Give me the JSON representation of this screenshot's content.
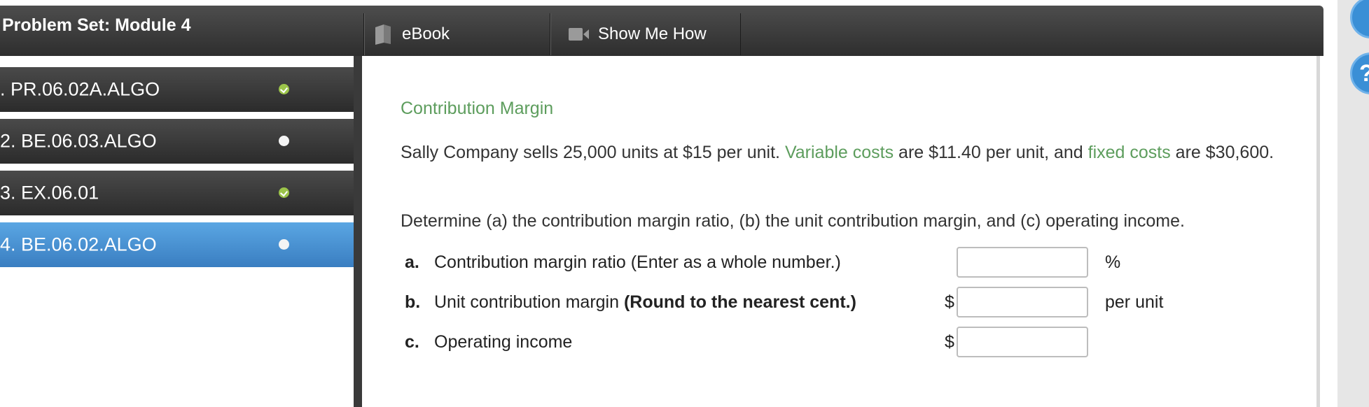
{
  "header": {
    "title": "Problem Set: Module 4",
    "tools": [
      {
        "label": "eBook",
        "icon": "book-icon"
      },
      {
        "label": "Show Me How",
        "icon": "video-icon"
      }
    ]
  },
  "nav": {
    "items": [
      {
        "label": ". PR.06.02A.ALGO",
        "status": "complete",
        "active": false
      },
      {
        "label": "2. BE.06.03.ALGO",
        "status": "incomplete",
        "active": false
      },
      {
        "label": "3. EX.06.01",
        "status": "complete",
        "active": false
      },
      {
        "label": "4. BE.06.02.ALGO",
        "status": "incomplete",
        "active": true
      }
    ]
  },
  "content": {
    "section_title": "Contribution Margin",
    "para1_part1": "Sally Company sells 25,000 units at $15 per unit. ",
    "para1_link1": "Variable costs",
    "para1_part2": " are $11.40 per unit, and ",
    "para1_link2": "fixed costs",
    "para1_part3": " are $30,600.",
    "para2": "Determine (a) the contribution margin ratio, (b) the unit contribution margin, and (c) operating income.",
    "questions": [
      {
        "letter": "a.",
        "text": "Contribution margin ratio (Enter as a whole number.)",
        "bold": "",
        "prefix": "",
        "unit": "%",
        "value": ""
      },
      {
        "letter": "b.",
        "text": "Unit contribution margin ",
        "bold": "(Round to the nearest cent.)",
        "prefix": "$",
        "unit": "per unit",
        "value": ""
      },
      {
        "letter": "c.",
        "text": "Operating income",
        "bold": "",
        "prefix": "$",
        "unit": "",
        "value": ""
      }
    ]
  },
  "colors": {
    "link_green": "#5d9d5d",
    "active_blue": "#4a90d6",
    "complete_green": "#9cc44a"
  }
}
